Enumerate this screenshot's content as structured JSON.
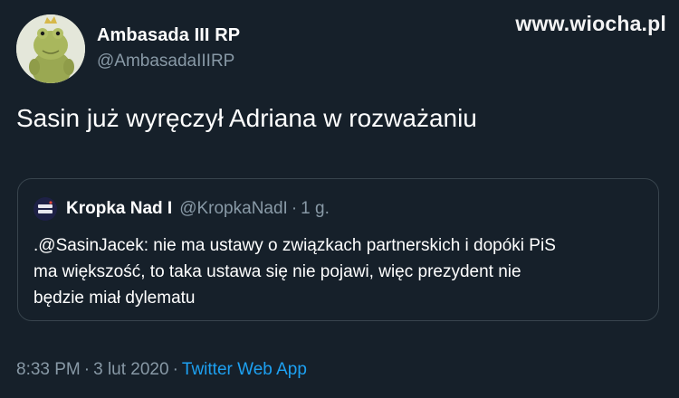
{
  "tweet": {
    "author_name": "Ambasada III RP",
    "author_handle": "@AmbasadaIIIRP",
    "text": "Sasin już wyręczył Adriana w rozważaniu"
  },
  "quoted_tweet": {
    "author_name": "Kropka Nad I",
    "author_handle": "@KropkaNadI",
    "separator": "·",
    "time": "1 g.",
    "text_lines": [
      ".@SasinJacek: nie ma ustawy o związkach partnerskich i dopóki PiS",
      "ma większość, to taka ustawa się nie pojawi, więc prezydent nie",
      "będzie miał dylematu"
    ]
  },
  "meta": {
    "time": "8:33 PM",
    "separator": "·",
    "date": "3 lut 2020",
    "source": "Twitter Web App"
  },
  "watermark": {
    "text": "www.wiocha.pl"
  },
  "colors": {
    "background": "#16202a",
    "text_primary": "#ffffff",
    "text_secondary": "#8899a6",
    "link": "#1da1f2",
    "border": "#38444d"
  },
  "icons": {
    "author_avatar": "plush-frog-with-crown-avatar",
    "quoted_avatar": "kropka-nad-i-logo-avatar"
  }
}
